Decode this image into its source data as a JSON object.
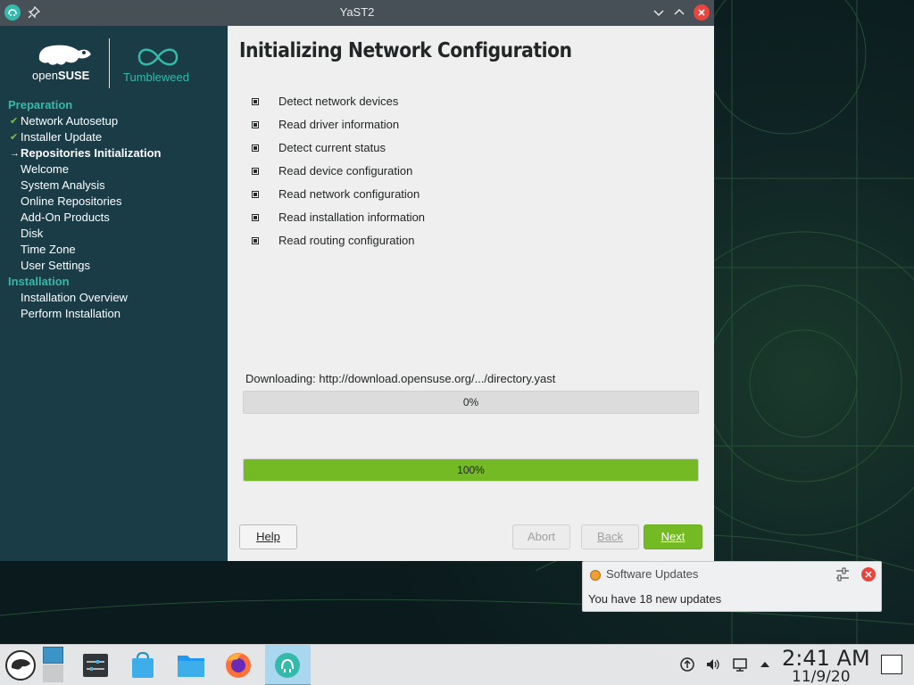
{
  "window": {
    "title": "YaST2"
  },
  "sidebar": {
    "logo_opensuse_a": "open",
    "logo_opensuse_b": "SUSE",
    "logo_tumbleweed": "Tumbleweed",
    "groups": [
      {
        "label": "Preparation",
        "steps": [
          {
            "label": "Network Autosetup",
            "state": "done"
          },
          {
            "label": "Installer Update",
            "state": "done"
          },
          {
            "label": "Repositories Initialization",
            "state": "current"
          },
          {
            "label": "Welcome",
            "state": "todo"
          },
          {
            "label": "System Analysis",
            "state": "todo"
          },
          {
            "label": "Online Repositories",
            "state": "todo"
          },
          {
            "label": "Add-On Products",
            "state": "todo"
          },
          {
            "label": "Disk",
            "state": "todo"
          },
          {
            "label": "Time Zone",
            "state": "todo"
          },
          {
            "label": "User Settings",
            "state": "todo"
          }
        ]
      },
      {
        "label": "Installation",
        "steps": [
          {
            "label": "Installation Overview",
            "state": "todo"
          },
          {
            "label": "Perform Installation",
            "state": "todo"
          }
        ]
      }
    ]
  },
  "content": {
    "heading": "Initializing Network Configuration",
    "tasks": [
      "Detect network devices",
      "Read driver information",
      "Detect current status",
      "Read device configuration",
      "Read network configuration",
      "Read installation information",
      "Read routing configuration"
    ],
    "download_label": "Downloading: http://download.opensuse.org/.../directory.yast",
    "progress1": {
      "value": 0,
      "text": "0%"
    },
    "progress2": {
      "value": 100,
      "text": "100%"
    }
  },
  "buttons": {
    "help": "Help",
    "abort": "Abort",
    "back": "Back",
    "next": "Next"
  },
  "notification": {
    "title": "Software Updates",
    "body": "You have 18 new updates"
  },
  "taskbar": {
    "time": "2:41 AM",
    "date": "11/9/20"
  },
  "colors": {
    "accent": "#73ba25",
    "sidebar": "#1a3c47",
    "sidebar_heading": "#35b9ab",
    "close": "#e9443d"
  }
}
